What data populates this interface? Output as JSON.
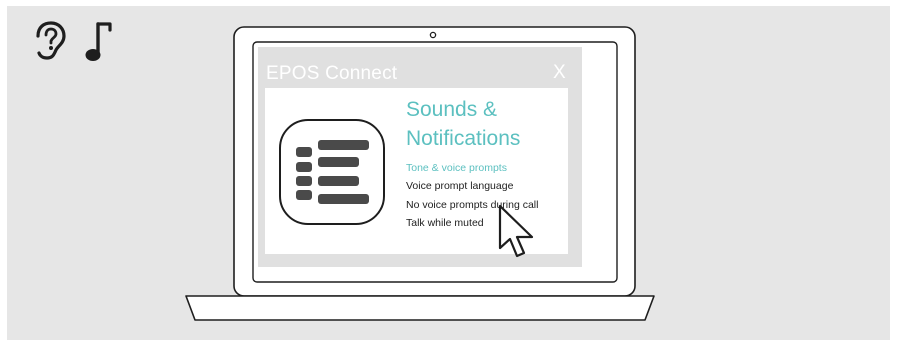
{
  "app": {
    "title": "EPOS Connect",
    "close_label": "X"
  },
  "panel": {
    "heading_line1": "Sounds &",
    "heading_line2": "Notifications",
    "subheading": "Tone & voice prompts",
    "menu_items": [
      "Voice prompt language",
      "No voice prompts during call",
      "Talk while muted"
    ]
  },
  "icons": {
    "top_left": [
      "ear-question-icon",
      "music-note-icon"
    ],
    "app_logo": "epos-logo-icon",
    "pointer": "mouse-cursor-icon"
  },
  "colors": {
    "background": "#e6e6e6",
    "accent": "#5cc0c0",
    "screen": "#e0e0e0",
    "outline": "#1e1e1e"
  }
}
